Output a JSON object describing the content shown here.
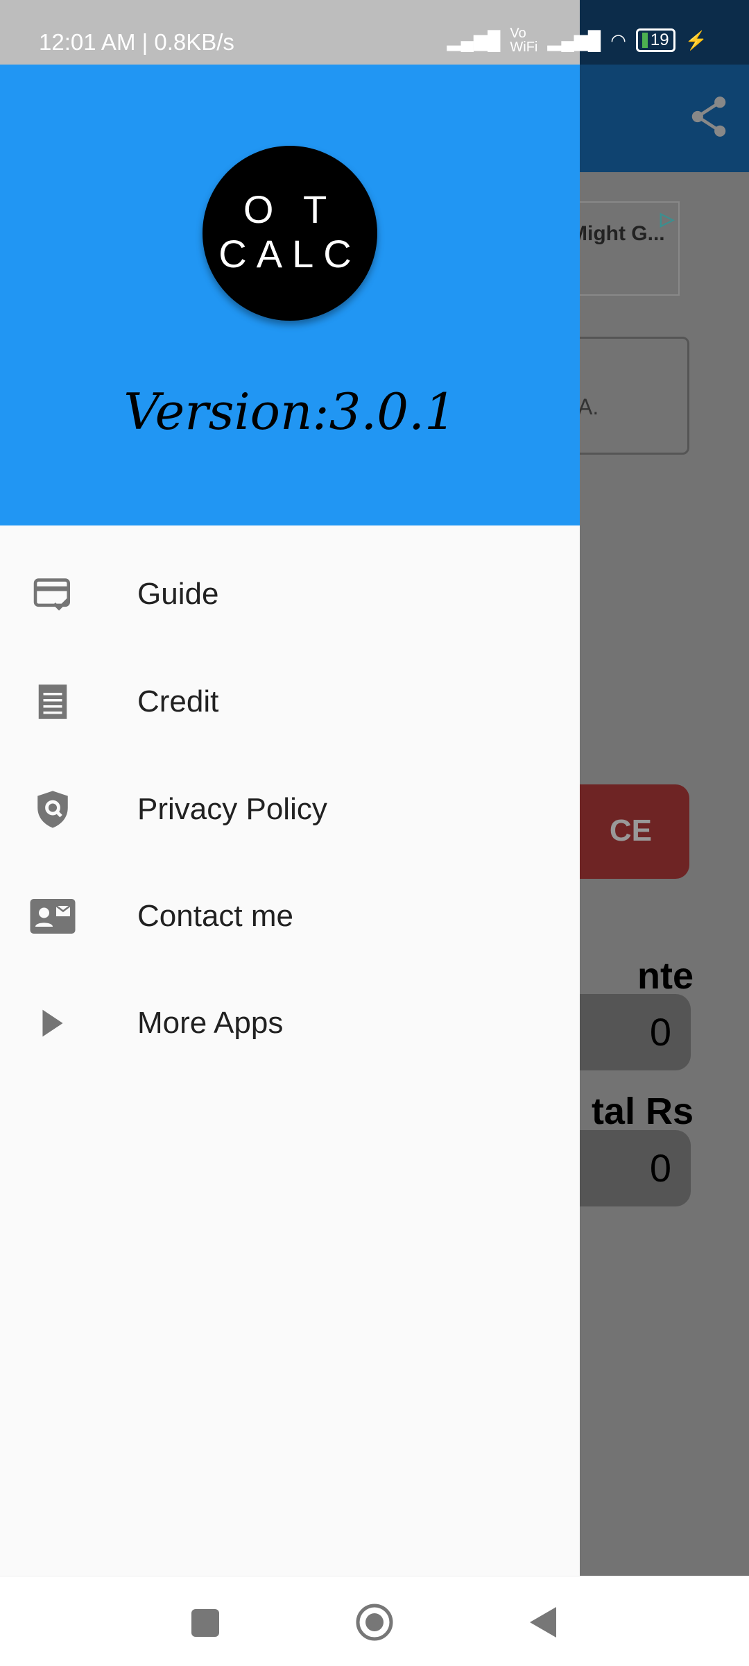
{
  "status_bar": {
    "time": "12:01 AM | 0.8KB/s",
    "vowifi": "Vo WiFi",
    "battery": "19"
  },
  "background": {
    "ad_text": "Might G...",
    "field_text": "A.",
    "ce_button": "CE",
    "label1": "nte",
    "value1": "0",
    "label2": "tal Rs",
    "value2": "0"
  },
  "drawer": {
    "logo_line1": "O T",
    "logo_line2": "CALC",
    "version": "Version:3.0.1",
    "items": [
      {
        "label": "Guide",
        "icon": "card-check-icon"
      },
      {
        "label": "Credit",
        "icon": "receipt-icon"
      },
      {
        "label": "Privacy Policy",
        "icon": "shield-search-icon"
      },
      {
        "label": "Contact me",
        "icon": "contact-card-icon"
      },
      {
        "label": "More Apps",
        "icon": "play-arrow-icon"
      }
    ]
  },
  "colors": {
    "header": "#2196f3",
    "appbar": "#0f4370",
    "ce": "#6e2424"
  }
}
